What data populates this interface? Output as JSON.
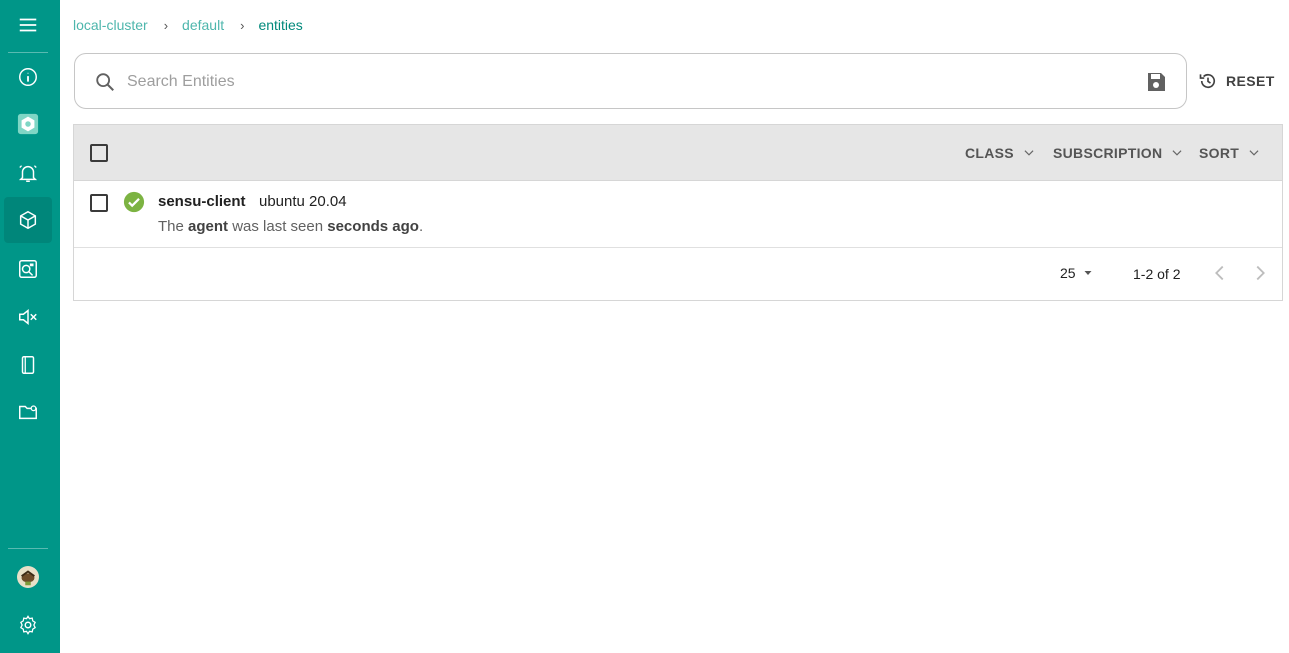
{
  "breadcrumb": {
    "items": [
      "local-cluster",
      "default",
      "entities"
    ],
    "separator": "›"
  },
  "search": {
    "placeholder": "Search Entities",
    "value": ""
  },
  "reset_label": "RESET",
  "filters": {
    "class": "CLASS",
    "subscription": "SUBSCRIPTION",
    "sort": "SORT"
  },
  "entities": [
    {
      "name": "sensu-client",
      "os": "ubuntu 20.04",
      "desc_prefix": "The ",
      "desc_agent": "agent",
      "desc_middle": " was last seen ",
      "desc_time": "seconds ago",
      "desc_suffix": ".",
      "status": "passing"
    }
  ],
  "pagination": {
    "per_page": "25",
    "range": "1-2 of 2"
  },
  "sidebar": {
    "items": [
      "menu-icon",
      "info-icon",
      "namespace-icon",
      "events-icon",
      "entities-icon",
      "checks-icon",
      "silences-icon",
      "handlers-icon",
      "config-icon"
    ],
    "bottom": [
      "avatar",
      "settings-icon"
    ]
  },
  "colors": {
    "sidebar": "#009688",
    "accent": "#00897b",
    "success": "#7cb342"
  }
}
